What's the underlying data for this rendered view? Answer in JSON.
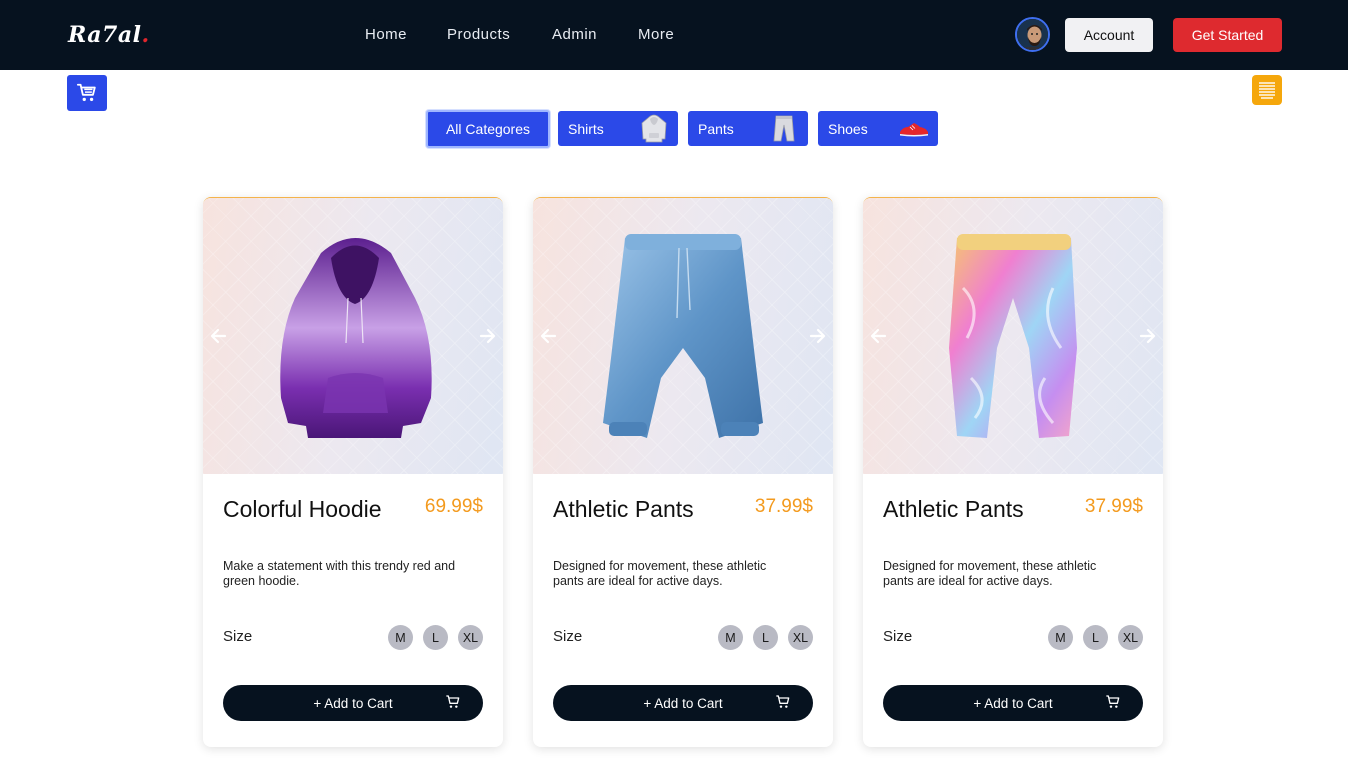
{
  "brand": {
    "name": "Ra7al",
    "dot": "."
  },
  "nav": {
    "items": [
      {
        "label": "Home"
      },
      {
        "label": "Products"
      },
      {
        "label": "Admin"
      },
      {
        "label": "More"
      }
    ]
  },
  "header": {
    "account_label": "Account",
    "get_started_label": "Get Started"
  },
  "categories": [
    {
      "label": "All Categores",
      "active": true
    },
    {
      "label": "Shirts",
      "icon": "hoodie-icon"
    },
    {
      "label": "Pants",
      "icon": "pants-icon"
    },
    {
      "label": "Shoes",
      "icon": "shoe-icon"
    }
  ],
  "products": [
    {
      "title": "Colorful Hoodie",
      "price": "69.99$",
      "description": "Make a statement with this trendy red and green hoodie.",
      "size_label": "Size",
      "sizes": [
        "M",
        "L",
        "XL"
      ],
      "add_label": "+ Add to Cart",
      "image": "purple-hoodie"
    },
    {
      "title": "Athletic Pants",
      "price": "37.99$",
      "description": "Designed for movement, these athletic pants are ideal for active days.",
      "size_label": "Size",
      "sizes": [
        "M",
        "L",
        "XL"
      ],
      "add_label": "+ Add to Cart",
      "image": "blue-pants"
    },
    {
      "title": "Athletic Pants",
      "price": "37.99$",
      "description": "Designed for movement, these athletic pants are ideal for active days.",
      "size_label": "Size",
      "sizes": [
        "M",
        "L",
        "XL"
      ],
      "add_label": "+ Add to Cart",
      "image": "holographic-pants"
    }
  ],
  "colors": {
    "header_bg": "#06121f",
    "primary": "#2b49e8",
    "danger": "#de2a2f",
    "accent": "#f39a1e",
    "menu_bg": "#f5a70c"
  }
}
